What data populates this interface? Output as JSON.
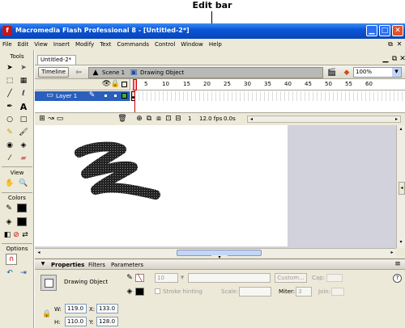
{
  "callout": {
    "label": "Edit bar"
  },
  "window": {
    "title": "Macromedia Flash Professional 8 - [Untitled-2*]"
  },
  "menu": [
    "File",
    "Edit",
    "View",
    "Insert",
    "Modify",
    "Text",
    "Commands",
    "Control",
    "Window",
    "Help"
  ],
  "tools": {
    "header": "Tools",
    "view_label": "View",
    "colors_label": "Colors",
    "options_label": "Options"
  },
  "document": {
    "tab": "Untitled-2*",
    "timeline_button": "Timeline",
    "scene": "Scene 1",
    "drawing_object": "Drawing Object",
    "zoom": "100%"
  },
  "timeline": {
    "layer_name": "Layer 1",
    "frame_numbers": [
      "5",
      "10",
      "15",
      "20",
      "25",
      "30",
      "35",
      "40",
      "45",
      "50",
      "55",
      "60"
    ],
    "current_frame": "1",
    "fps": "12.0 fps",
    "time": "0.0s"
  },
  "properties": {
    "tabs": [
      "Properties",
      "Filters",
      "Parameters"
    ],
    "object_type": "Drawing Object",
    "stroke_size": "10",
    "custom_button": "Custom...",
    "cap_label": "Cap:",
    "stroke_hinting": "Stroke hinting",
    "scale_label": "Scale:",
    "miter_label": "Miter:",
    "miter_value": "3",
    "join_label": "Join:",
    "w_label": "W:",
    "w_value": "119.0",
    "h_label": "H:",
    "h_value": "110.0",
    "x_label": "X:",
    "x_value": "133.0",
    "y_label": "Y:",
    "y_value": "128.0"
  },
  "colors": {
    "titlebar": "#0a55d8",
    "stage_bg": "#ffffff",
    "pasteboard": "#d2d2dc",
    "chrome": "#ece9d8",
    "playhead": "#cc0000"
  }
}
